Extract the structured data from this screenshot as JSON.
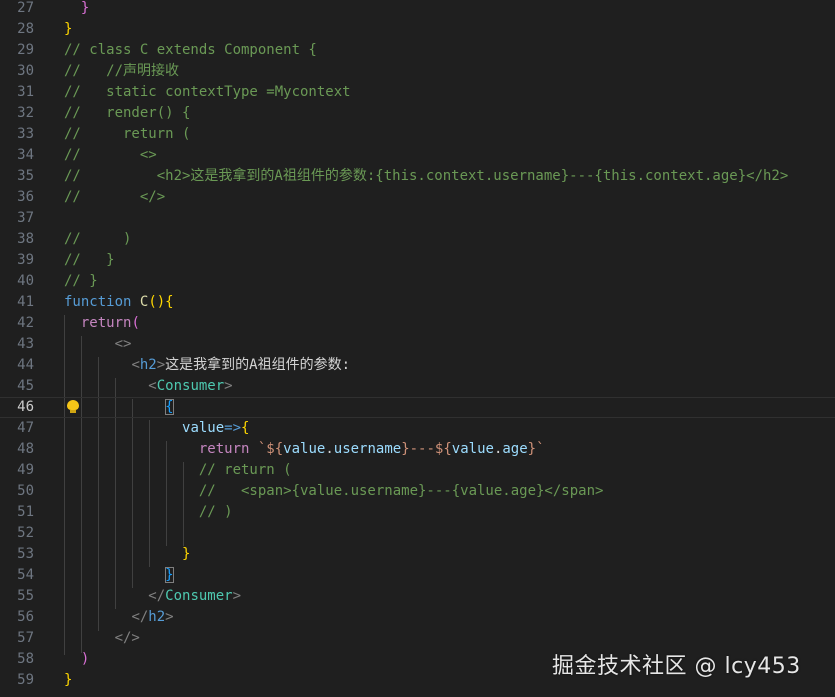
{
  "editor": {
    "theme_colors": {
      "background": "#1f1f1f",
      "comment": "#6a9955",
      "keyword": "#569cd6",
      "control": "#c586c0",
      "function": "#dcdcaa",
      "component": "#4ec9b0",
      "variable": "#9cdcfe",
      "string": "#ce9178"
    },
    "active_line": 46,
    "lightbulb_icon": "lightbulb-icon",
    "lines": [
      {
        "n": 27,
        "tokens": [
          {
            "t": "  "
          },
          {
            "t": "}",
            "c": "t-br2"
          }
        ]
      },
      {
        "n": 28,
        "tokens": [
          {
            "t": "}",
            "c": "t-br1"
          }
        ]
      },
      {
        "n": 29,
        "tokens": [
          {
            "t": "// class C extends Component {",
            "c": "t-com"
          }
        ]
      },
      {
        "n": 30,
        "tokens": [
          {
            "t": "//   //声明接收",
            "c": "t-com"
          }
        ]
      },
      {
        "n": 31,
        "tokens": [
          {
            "t": "//   static contextType =Mycontext",
            "c": "t-com"
          }
        ]
      },
      {
        "n": 32,
        "tokens": [
          {
            "t": "//   render() {",
            "c": "t-com"
          }
        ]
      },
      {
        "n": 33,
        "tokens": [
          {
            "t": "//     return (",
            "c": "t-com"
          }
        ]
      },
      {
        "n": 34,
        "tokens": [
          {
            "t": "//       <>",
            "c": "t-com"
          }
        ]
      },
      {
        "n": 35,
        "tokens": [
          {
            "t": "//         <h2>这是我拿到的A祖组件的参数:{this.context.username}---{this.context.age}</h2>",
            "c": "t-com"
          }
        ]
      },
      {
        "n": 36,
        "tokens": [
          {
            "t": "//       </>",
            "c": "t-com"
          }
        ]
      },
      {
        "n": 37,
        "tokens": []
      },
      {
        "n": 38,
        "tokens": [
          {
            "t": "//     )",
            "c": "t-com"
          }
        ]
      },
      {
        "n": 39,
        "tokens": [
          {
            "t": "//   }",
            "c": "t-com"
          }
        ]
      },
      {
        "n": 40,
        "tokens": [
          {
            "t": "// }",
            "c": "t-com"
          }
        ]
      },
      {
        "n": 41,
        "tokens": [
          {
            "t": "function",
            "c": "t-kw"
          },
          {
            "t": " "
          },
          {
            "t": "C",
            "c": "t-fn"
          },
          {
            "t": "(){",
            "c": "t-br1"
          }
        ]
      },
      {
        "n": 42,
        "tokens": [
          {
            "t": "  "
          },
          {
            "t": "return",
            "c": "t-ctrl"
          },
          {
            "t": "(",
            "c": "t-br2"
          }
        ]
      },
      {
        "n": 43,
        "tokens": [
          {
            "t": "      "
          },
          {
            "t": "<>",
            "c": "t-tag"
          }
        ]
      },
      {
        "n": 44,
        "tokens": [
          {
            "t": "        "
          },
          {
            "t": "<",
            "c": "t-tag"
          },
          {
            "t": "h2",
            "c": "t-tagname"
          },
          {
            "t": ">",
            "c": "t-tag"
          },
          {
            "t": "这是我拿到的A祖组件的参数:",
            "c": "t-text"
          }
        ]
      },
      {
        "n": 45,
        "tokens": [
          {
            "t": "          "
          },
          {
            "t": "<",
            "c": "t-tag"
          },
          {
            "t": "Consumer",
            "c": "t-comp"
          },
          {
            "t": ">",
            "c": "t-tag"
          }
        ]
      },
      {
        "n": 46,
        "tokens": [
          {
            "t": "            "
          },
          {
            "t": "{",
            "c": "t-br3",
            "box": true
          }
        ]
      },
      {
        "n": 47,
        "tokens": [
          {
            "t": "              "
          },
          {
            "t": "value",
            "c": "t-var"
          },
          {
            "t": "=>",
            "c": "t-kw"
          },
          {
            "t": "{",
            "c": "t-br1"
          }
        ]
      },
      {
        "n": 48,
        "tokens": [
          {
            "t": "                "
          },
          {
            "t": "return",
            "c": "t-ctrl"
          },
          {
            "t": " "
          },
          {
            "t": "`${",
            "c": "t-str"
          },
          {
            "t": "value",
            "c": "t-var"
          },
          {
            "t": ".",
            "c": "t-op"
          },
          {
            "t": "username",
            "c": "t-var"
          },
          {
            "t": "}---${",
            "c": "t-str"
          },
          {
            "t": "value",
            "c": "t-var"
          },
          {
            "t": ".",
            "c": "t-op"
          },
          {
            "t": "age",
            "c": "t-var"
          },
          {
            "t": "}`",
            "c": "t-str"
          }
        ]
      },
      {
        "n": 49,
        "tokens": [
          {
            "t": "                "
          },
          {
            "t": "// return (",
            "c": "t-com"
          }
        ]
      },
      {
        "n": 50,
        "tokens": [
          {
            "t": "                "
          },
          {
            "t": "//   <span>{value.username}---{value.age}</span>",
            "c": "t-com"
          }
        ]
      },
      {
        "n": 51,
        "tokens": [
          {
            "t": "                "
          },
          {
            "t": "// )",
            "c": "t-com"
          }
        ]
      },
      {
        "n": 52,
        "tokens": []
      },
      {
        "n": 53,
        "tokens": [
          {
            "t": "              "
          },
          {
            "t": "}",
            "c": "t-br1"
          }
        ]
      },
      {
        "n": 54,
        "tokens": [
          {
            "t": "            "
          },
          {
            "t": "}",
            "c": "t-br3",
            "box": true
          }
        ]
      },
      {
        "n": 55,
        "tokens": [
          {
            "t": "          "
          },
          {
            "t": "</",
            "c": "t-tag"
          },
          {
            "t": "Consumer",
            "c": "t-comp"
          },
          {
            "t": ">",
            "c": "t-tag"
          }
        ]
      },
      {
        "n": 56,
        "tokens": [
          {
            "t": "        "
          },
          {
            "t": "</",
            "c": "t-tag"
          },
          {
            "t": "h2",
            "c": "t-tagname"
          },
          {
            "t": ">",
            "c": "t-tag"
          }
        ]
      },
      {
        "n": 57,
        "tokens": [
          {
            "t": "      "
          },
          {
            "t": "</>",
            "c": "t-tag"
          }
        ]
      },
      {
        "n": 58,
        "tokens": [
          {
            "t": "  "
          },
          {
            "t": ")",
            "c": "t-br2"
          }
        ]
      },
      {
        "n": 59,
        "tokens": [
          {
            "t": "}",
            "c": "t-br1"
          }
        ]
      }
    ]
  },
  "watermark": {
    "text": "掘金技术社区 @ lcy453"
  }
}
